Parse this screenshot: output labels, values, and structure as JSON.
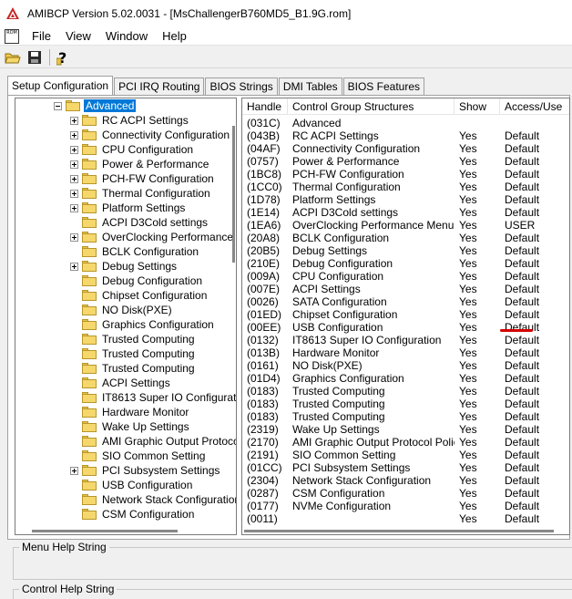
{
  "window": {
    "title": "AMIBCP Version 5.02.0031 - [MsChallengerB760MD5_B1.9G.rom]"
  },
  "menu": {
    "rom_icon_text": "ROM",
    "items": [
      "File",
      "View",
      "Window",
      "Help"
    ]
  },
  "toolbar": {
    "buttons": [
      "open-folder-icon",
      "save-icon",
      "help-icon"
    ]
  },
  "tabs": [
    "Setup Configuration",
    "PCI IRQ Routing",
    "BIOS Strings",
    "DMI Tables",
    "BIOS Features"
  ],
  "tree": {
    "items": [
      {
        "label": "Advanced",
        "exp": "minus",
        "selected": true,
        "level": 0
      },
      {
        "label": "RC ACPI Settings",
        "exp": "plus",
        "level": 1
      },
      {
        "label": "Connectivity Configuration",
        "exp": "plus",
        "level": 1
      },
      {
        "label": "CPU Configuration",
        "exp": "plus",
        "level": 1
      },
      {
        "label": "Power & Performance",
        "exp": "plus",
        "level": 1
      },
      {
        "label": "PCH-FW Configuration",
        "exp": "plus",
        "level": 1
      },
      {
        "label": "Thermal Configuration",
        "exp": "plus",
        "level": 1
      },
      {
        "label": "Platform Settings",
        "exp": "plus",
        "level": 1
      },
      {
        "label": "ACPI D3Cold settings",
        "exp": "none",
        "level": 1
      },
      {
        "label": "OverClocking Performance Menu",
        "exp": "plus",
        "level": 1
      },
      {
        "label": "BCLK Configuration",
        "exp": "none",
        "level": 1
      },
      {
        "label": "Debug Settings",
        "exp": "plus",
        "level": 1
      },
      {
        "label": "Debug Configuration",
        "exp": "none",
        "level": 1
      },
      {
        "label": "Chipset Configuration",
        "exp": "none",
        "level": 1
      },
      {
        "label": "NO Disk(PXE)",
        "exp": "none",
        "level": 1
      },
      {
        "label": "Graphics Configuration",
        "exp": "none",
        "level": 1
      },
      {
        "label": "Trusted Computing",
        "exp": "none",
        "level": 1
      },
      {
        "label": "Trusted Computing",
        "exp": "none",
        "level": 1
      },
      {
        "label": "Trusted Computing",
        "exp": "none",
        "level": 1
      },
      {
        "label": "ACPI Settings",
        "exp": "none",
        "level": 1
      },
      {
        "label": "IT8613 Super IO Configuration",
        "exp": "none",
        "level": 1
      },
      {
        "label": "Hardware Monitor",
        "exp": "none",
        "level": 1
      },
      {
        "label": "Wake Up Settings",
        "exp": "none",
        "level": 1
      },
      {
        "label": "AMI Graphic Output Protocol Policy",
        "exp": "none",
        "level": 1
      },
      {
        "label": "SIO Common Setting",
        "exp": "none",
        "level": 1
      },
      {
        "label": "PCI Subsystem Settings",
        "exp": "plus",
        "level": 1
      },
      {
        "label": "USB Configuration",
        "exp": "none",
        "level": 1
      },
      {
        "label": "Network Stack Configuration",
        "exp": "none",
        "level": 1
      },
      {
        "label": "CSM Configuration",
        "exp": "none",
        "level": 1
      }
    ]
  },
  "table": {
    "headers": [
      "Handle",
      "Control Group Structures",
      "Show",
      "Access/Use"
    ],
    "rows": [
      [
        "(031C)",
        "Advanced",
        "",
        ""
      ],
      [
        "(043B)",
        "RC ACPI Settings",
        "Yes",
        "Default"
      ],
      [
        "(04AF)",
        "Connectivity Configuration",
        "Yes",
        "Default"
      ],
      [
        "(0757)",
        "Power & Performance",
        "Yes",
        "Default"
      ],
      [
        "(1BC8)",
        "PCH-FW Configuration",
        "Yes",
        "Default"
      ],
      [
        "(1CC0)",
        "Thermal Configuration",
        "Yes",
        "Default"
      ],
      [
        "(1D78)",
        "Platform Settings",
        "Yes",
        "Default"
      ],
      [
        "(1E14)",
        "ACPI D3Cold settings",
        "Yes",
        "Default"
      ],
      [
        "(1EA6)",
        "OverClocking Performance Menu",
        "Yes",
        "USER"
      ],
      [
        "(20A8)",
        "BCLK Configuration",
        "Yes",
        "Default"
      ],
      [
        "(20B5)",
        "Debug Settings",
        "Yes",
        "Default"
      ],
      [
        "(210E)",
        "Debug Configuration",
        "Yes",
        "Default"
      ],
      [
        "(009A)",
        "CPU Configuration",
        "Yes",
        "Default"
      ],
      [
        "(007E)",
        "ACPI Settings",
        "Yes",
        "Default"
      ],
      [
        "(0026)",
        "SATA Configuration",
        "Yes",
        "Default"
      ],
      [
        "(01ED)",
        "Chipset Configuration",
        "Yes",
        "Default"
      ],
      [
        "(00EE)",
        "USB Configuration",
        "Yes",
        "Default"
      ],
      [
        "(0132)",
        "IT8613 Super IO Configuration",
        "Yes",
        "Default"
      ],
      [
        "(013B)",
        "Hardware Monitor",
        "Yes",
        "Default"
      ],
      [
        "(0161)",
        "NO Disk(PXE)",
        "Yes",
        "Default"
      ],
      [
        "(01D4)",
        "Graphics Configuration",
        "Yes",
        "Default"
      ],
      [
        "(0183)",
        "Trusted Computing",
        "Yes",
        "Default"
      ],
      [
        "(0183)",
        "Trusted Computing",
        "Yes",
        "Default"
      ],
      [
        "(0183)",
        "Trusted Computing",
        "Yes",
        "Default"
      ],
      [
        "(2319)",
        "Wake Up Settings",
        "Yes",
        "Default"
      ],
      [
        "(2170)",
        "AMI Graphic Output Protocol Policy",
        "Yes",
        "Default"
      ],
      [
        "(2191)",
        "SIO Common Setting",
        "Yes",
        "Default"
      ],
      [
        "(01CC)",
        "PCI Subsystem Settings",
        "Yes",
        "Default"
      ],
      [
        "(2304)",
        "Network Stack Configuration",
        "Yes",
        "Default"
      ],
      [
        "(0287)",
        "CSM Configuration",
        "Yes",
        "Default"
      ],
      [
        "(0177)",
        "NVMe Configuration",
        "Yes",
        "Default"
      ],
      [
        "(0011)",
        "",
        "Yes",
        "Default"
      ]
    ]
  },
  "help": {
    "menu_help": "Menu Help String",
    "control_help": "Control Help String"
  },
  "colors": {
    "selection": "#0078d7",
    "annotation": "#d40000",
    "folder": "#f6d76b"
  }
}
